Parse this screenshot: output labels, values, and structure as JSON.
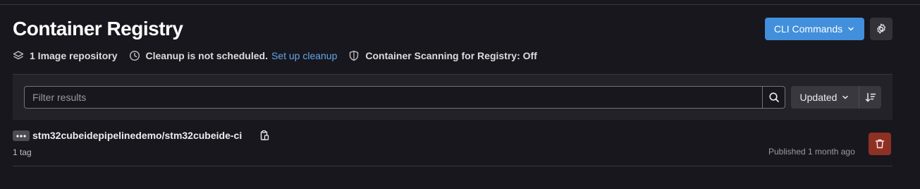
{
  "header": {
    "title": "Container Registry",
    "cli_commands_label": "CLI Commands"
  },
  "meta": {
    "repository_count": "1 Image repository",
    "cleanup_status": "Cleanup is not scheduled.",
    "cleanup_link": "Set up cleanup",
    "scanning_status": "Container Scanning for Registry: Off"
  },
  "filter": {
    "placeholder": "Filter results",
    "value": "",
    "sort_label": "Updated"
  },
  "repositories": [
    {
      "name": "stm32cubeidepipelinedemo/stm32cubeide-ci",
      "tags": "1 tag",
      "published": "Published 1 month ago"
    }
  ],
  "icons": {
    "layers": "layers-icon",
    "clock": "clock-icon",
    "shield": "shield-icon",
    "gear": "gear-icon",
    "search": "search-icon",
    "sort": "sort-lowest-icon",
    "copy": "copy-to-clipboard-icon",
    "trash": "trash-icon",
    "ellipsis": "ellipsis-icon"
  },
  "colors": {
    "background": "#18171d",
    "primary_button": "#428fdc",
    "link": "#63a6e9",
    "danger_button": "#8d3124"
  }
}
